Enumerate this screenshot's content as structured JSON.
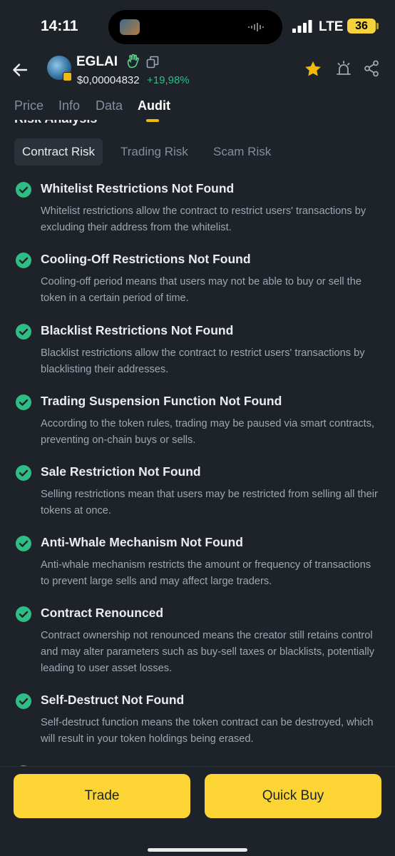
{
  "status_bar": {
    "time": "14:11",
    "network": "LTE",
    "battery": "36"
  },
  "header": {
    "token_name": "EGLAI",
    "price": "$0,00004832",
    "change": "+19,98%",
    "colors": {
      "positive": "#2ebd85",
      "accent": "#f0b90b"
    }
  },
  "tabs": [
    {
      "label": "Price"
    },
    {
      "label": "Info"
    },
    {
      "label": "Data"
    },
    {
      "label": "Audit",
      "active": true
    }
  ],
  "section_title": "Risk Analysis",
  "risk_tabs": [
    {
      "label": "Contract Risk",
      "active": true
    },
    {
      "label": "Trading Risk"
    },
    {
      "label": "Scam Risk"
    }
  ],
  "risks": [
    {
      "title": "Whitelist Restrictions Not Found",
      "description": "Whitelist restrictions allow the contract to restrict users' transactions by excluding their address from the whitelist."
    },
    {
      "title": "Cooling-Off Restrictions Not Found",
      "description": "Cooling-off period means that users may not be able to buy or sell the token in a certain period of time."
    },
    {
      "title": "Blacklist Restrictions Not Found",
      "description": "Blacklist restrictions allow the contract to restrict users' transactions by blacklisting their addresses."
    },
    {
      "title": "Trading Suspension Function Not Found",
      "description": "According to the token rules, trading may be paused via smart contracts, preventing on-chain buys or sells."
    },
    {
      "title": "Sale Restriction Not Found",
      "description": "Selling restrictions mean that users may be restricted from selling all their tokens at once."
    },
    {
      "title": "Anti-Whale Mechanism Not Found",
      "description": "Anti-whale mechanism restricts the amount or frequency of transactions to prevent large sells and may affect large traders."
    },
    {
      "title": "Contract Renounced",
      "description": "Contract ownership not renounced means the creator still retains control and may alter parameters such as buy-sell taxes or blacklists, potentially leading to user asset losses."
    },
    {
      "title": "Self-Destruct Not Found",
      "description": "Self-destruct function means the token contract can be destroyed, which will result in your token holdings being erased."
    }
  ],
  "footer": {
    "trade_label": "Trade",
    "quick_buy_label": "Quick Buy"
  },
  "icons": {
    "back": "arrow-left-icon",
    "copy": "copy-icon",
    "star": "star-icon",
    "alert": "alert-icon",
    "share": "share-icon",
    "check": "check-circle-icon"
  }
}
